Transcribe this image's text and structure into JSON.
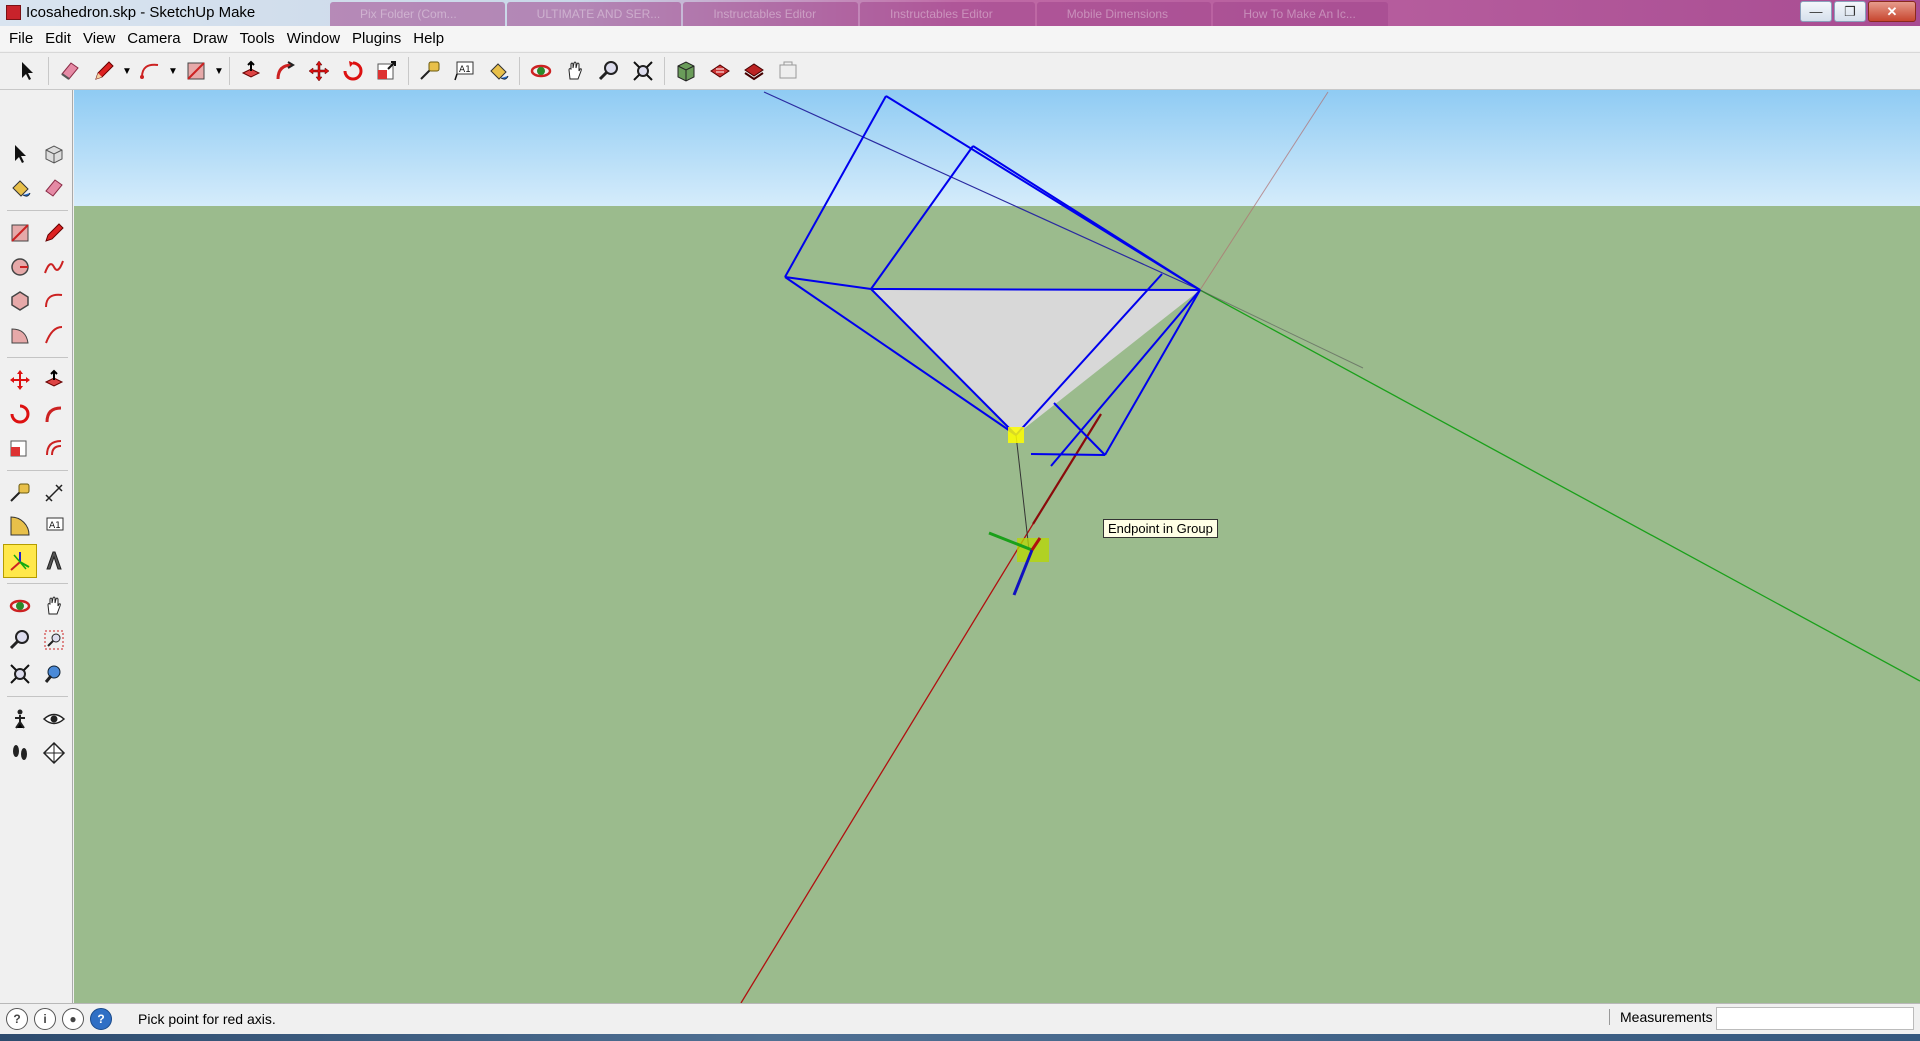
{
  "window": {
    "title": "Icosahedron.skp - SketchUp Make",
    "ghost_tabs": [
      "Pix Folder (Com...",
      "ULTIMATE AND SER...",
      "Instructables Editor",
      "Instructables Editor",
      "Mobile Dimensions",
      "How To Make An Ic..."
    ],
    "minimize_icon": "minimize-icon",
    "maximize_icon": "maximize-icon",
    "close_icon": "close-icon"
  },
  "menubar": {
    "items": [
      "File",
      "Edit",
      "View",
      "Camera",
      "Draw",
      "Tools",
      "Window",
      "Plugins",
      "Help"
    ]
  },
  "toolbar": {
    "icons": [
      "select-icon",
      "eraser-icon",
      "pencil-icon",
      "arc-icon",
      "rectangle-icon",
      "push-pull-icon",
      "follow-me-icon",
      "move-icon",
      "rotate-icon",
      "scale-icon",
      "tape-measure-icon",
      "text-icon",
      "paint-bucket-icon",
      "orbit-icon",
      "pan-icon",
      "zoom-icon",
      "zoom-extents-icon",
      "3d-warehouse-icon",
      "share-model-icon",
      "get-models-icon",
      "extension-icon"
    ]
  },
  "left_toolbar": {
    "active_tool": "axes-tool"
  },
  "viewport": {
    "tooltip": "Endpoint in Group",
    "colors": {
      "sky": "#a8d8f5",
      "ground": "#9bbb8d",
      "edges": "#0000ee",
      "face": "#d8d8d8",
      "red_axis": "#b01010",
      "green_axis": "#1aa01a",
      "blue_axis": "#1010c0",
      "inference": "#ffff00"
    }
  },
  "statusbar": {
    "message": "Pick point for red axis.",
    "measurements_label": "Measurements",
    "measurements_value": ""
  }
}
